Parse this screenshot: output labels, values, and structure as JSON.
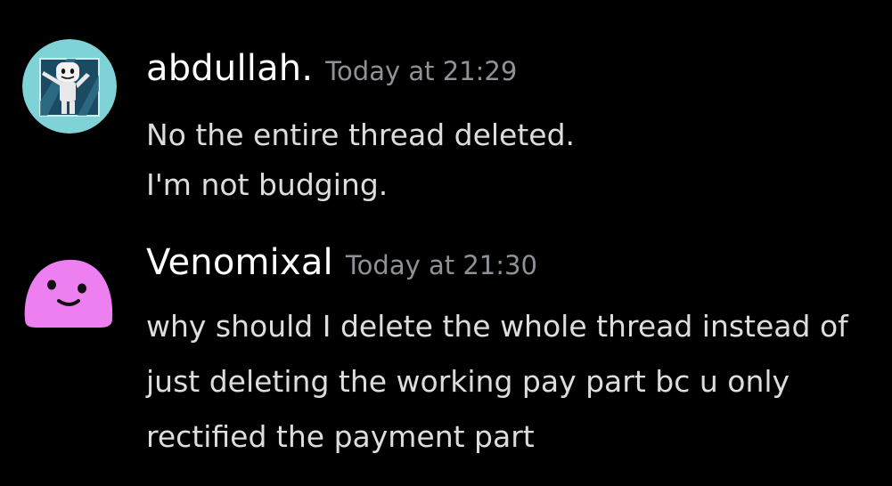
{
  "messages": [
    {
      "username": "abdullah.",
      "timestamp": "Today at 21:29",
      "avatar_icon": "marshmello-dab-avatar",
      "lines": [
        "No the entire thread deleted.",
        "I'm not budging."
      ]
    },
    {
      "username": "Venomixal",
      "timestamp": "Today at 21:30",
      "avatar_icon": "pink-slime-face-avatar",
      "lines": [
        "why should I delete the whole thread instead of",
        "just deleting the working pay part bc u only",
        "rectified the payment part"
      ]
    }
  ],
  "colors": {
    "background": "#000000",
    "username": "#ffffff",
    "timestamp": "#8e9297",
    "message_text": "#dcddde",
    "pink_avatar": "#ee7ff0"
  }
}
